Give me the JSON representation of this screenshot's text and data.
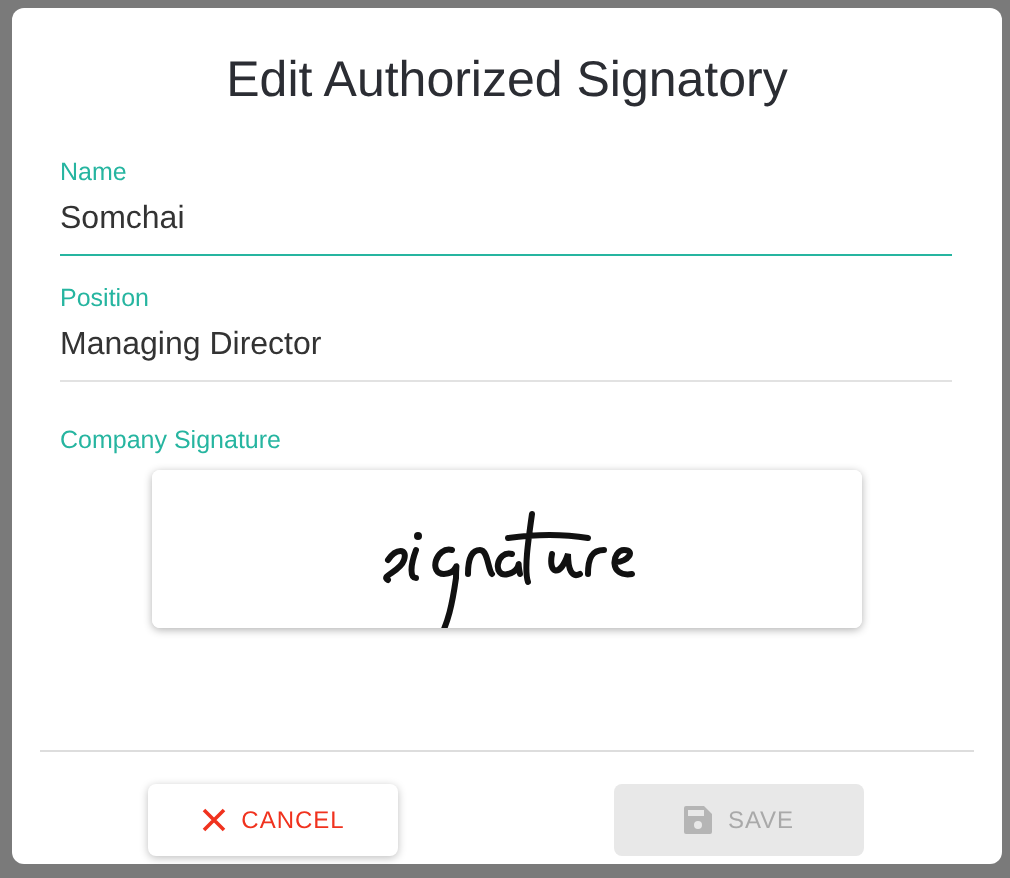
{
  "dialog": {
    "title": "Edit Authorized Signatory",
    "fields": [
      {
        "label": "Name",
        "value": "Somchai",
        "focused": true
      },
      {
        "label": "Position",
        "value": "Managing Director",
        "focused": false
      }
    ],
    "signature": {
      "label": "Company Signature"
    },
    "buttons": [
      {
        "kind": "cancel",
        "label": "CANCEL",
        "disabled": false
      },
      {
        "kind": "save",
        "label": "SAVE",
        "disabled": true
      }
    ]
  }
}
